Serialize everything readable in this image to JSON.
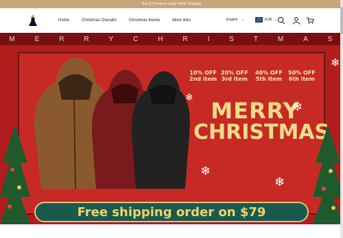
{
  "announcement": "Buy $79 more to enjoy FREE Shipping",
  "nav": {
    "items": [
      {
        "label": "Home"
      },
      {
        "label": "Christmas Overalls"
      },
      {
        "label": "Christmas theme"
      },
      {
        "label": "More links"
      }
    ]
  },
  "header": {
    "language": "English",
    "currency": "EUR",
    "icons": [
      "search-icon",
      "user-icon",
      "cart-icon"
    ]
  },
  "banner": {
    "top_letters": [
      "M",
      "E",
      "R",
      "R",
      "Y",
      "C",
      "H",
      "R",
      "I",
      "S",
      "T",
      "M",
      "A",
      "S"
    ],
    "offers": [
      {
        "pct": "10% OFF",
        "item": "2nd item"
      },
      {
        "pct": "20% OFF",
        "item": "3rd item"
      },
      {
        "pct": "40% OFF",
        "item": "5th item"
      },
      {
        "pct": "50% OFF",
        "item": "6th item"
      }
    ],
    "headline_1": "MERRY",
    "headline_2": "CHRISTMAS",
    "shipping": "Free shipping order on $79"
  },
  "colors": {
    "announce_bg": "#c9a57a",
    "banner_red": "#b01d1c",
    "gold": "#f6dc8a",
    "ship_bg": "#1a5a4e"
  }
}
